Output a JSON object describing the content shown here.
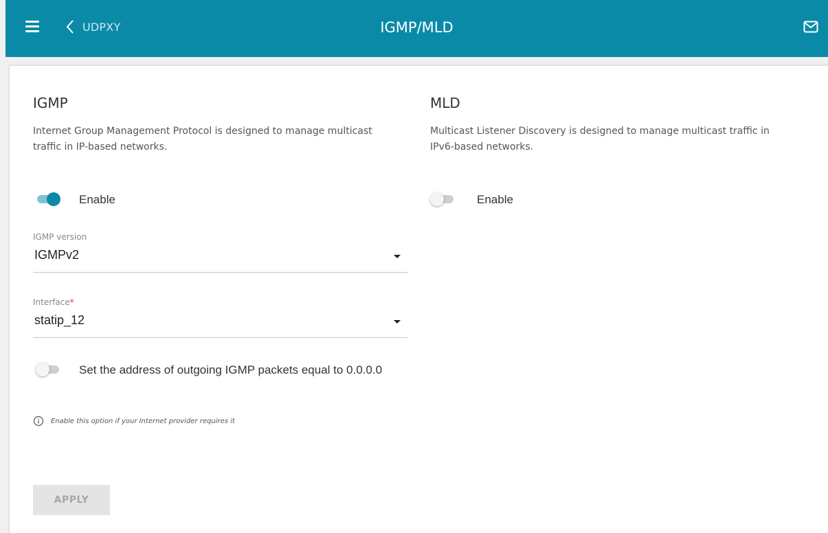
{
  "header": {
    "back_label": "UDPXY",
    "title": "IGMP/MLD"
  },
  "igmp": {
    "title": "IGMP",
    "description": "Internet Group Management Protocol is designed to manage multicast traffic in IP-based networks.",
    "enable_label": "Enable",
    "enabled": true,
    "version": {
      "label": "IGMP version",
      "value": "IGMPv2"
    },
    "interface": {
      "label": "Interface",
      "required_mark": "*",
      "value": "statip_12"
    },
    "outgoing_address": {
      "label": "Set the address of outgoing IGMP packets equal to 0.0.0.0",
      "enabled": false,
      "hint": "Enable this option if your Internet provider requires it"
    }
  },
  "mld": {
    "title": "MLD",
    "description": "Multicast Listener Discovery is designed to manage multicast traffic in IPv6-based networks.",
    "enable_label": "Enable",
    "enabled": false
  },
  "actions": {
    "apply_label": "APPLY"
  },
  "icons": {
    "menu": "menu-icon",
    "back": "chevron-left-icon",
    "mail": "mail-icon",
    "info": "info-icon"
  },
  "colors": {
    "accent": "#0b8aa8",
    "toggle_track_on": "#7fc3d6",
    "required": "#e0302a"
  }
}
